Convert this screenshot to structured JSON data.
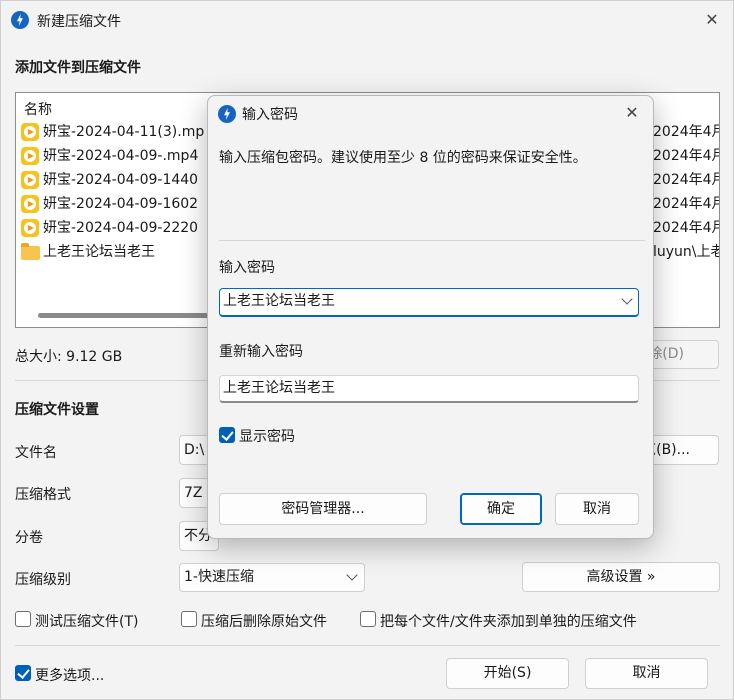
{
  "window": {
    "title": "新建压缩文件",
    "section_files": "添加文件到压缩文件",
    "list_header": "名称",
    "files": [
      {
        "name": "妍宝-2024-04-11(3).mp",
        "right": "2024年4月",
        "type": "video"
      },
      {
        "name": "妍宝-2024-04-09-.mp4",
        "right": "2024年4月",
        "type": "video"
      },
      {
        "name": "妍宝-2024-04-09-1440",
        "right": "2024年4月",
        "type": "video"
      },
      {
        "name": "妍宝-2024-04-09-1602",
        "right": "2024年4月",
        "type": "video"
      },
      {
        "name": "妍宝-2024-04-09-2220",
        "right": "2024年4月",
        "type": "video"
      },
      {
        "name": "上老王论坛当老王",
        "right": "luyun\\上老",
        "type": "folder"
      }
    ],
    "total_size": "总大小: 9.12 GB",
    "remove_button": "除(D)",
    "section_settings": "压缩文件设置",
    "filename_label": "文件名",
    "filename_value": "D:\\",
    "browse_button": "览(B)...",
    "format_label": "压缩格式",
    "format_value": "7Z",
    "split_label": "分卷",
    "split_value": "不分",
    "level_label": "压缩级别",
    "level_value": "1-快速压缩",
    "advanced_button": "高级设置 »",
    "options": {
      "test": "测试压缩文件(T)",
      "delete": "压缩后删除原始文件",
      "separate": "把每个文件/文件夹添加到单独的压缩文件"
    },
    "more_options": "更多选项...",
    "start_button": "开始(S)",
    "cancel_button": "取消"
  },
  "dialog": {
    "title": "输入密码",
    "hint": "输入压缩包密码。建议使用至少 8 位的密码来保证安全性。",
    "password_label": "输入密码",
    "password_value": "上老王论坛当老王",
    "confirm_label": "重新输入密码",
    "confirm_value": "上老王论坛当老王",
    "show_password": "显示密码",
    "manager_button": "密码管理器...",
    "ok_button": "确定",
    "cancel_button": "取消"
  },
  "colors": {
    "accent": "#0067c0",
    "checkbox_fill": "#005fb8",
    "video_icon": "#f8c21c",
    "folder_icon": "#f7c44d"
  },
  "states": {
    "test_checked": false,
    "delete_checked": false,
    "separate_checked": false,
    "more_options_checked": true,
    "show_password_checked": true
  }
}
